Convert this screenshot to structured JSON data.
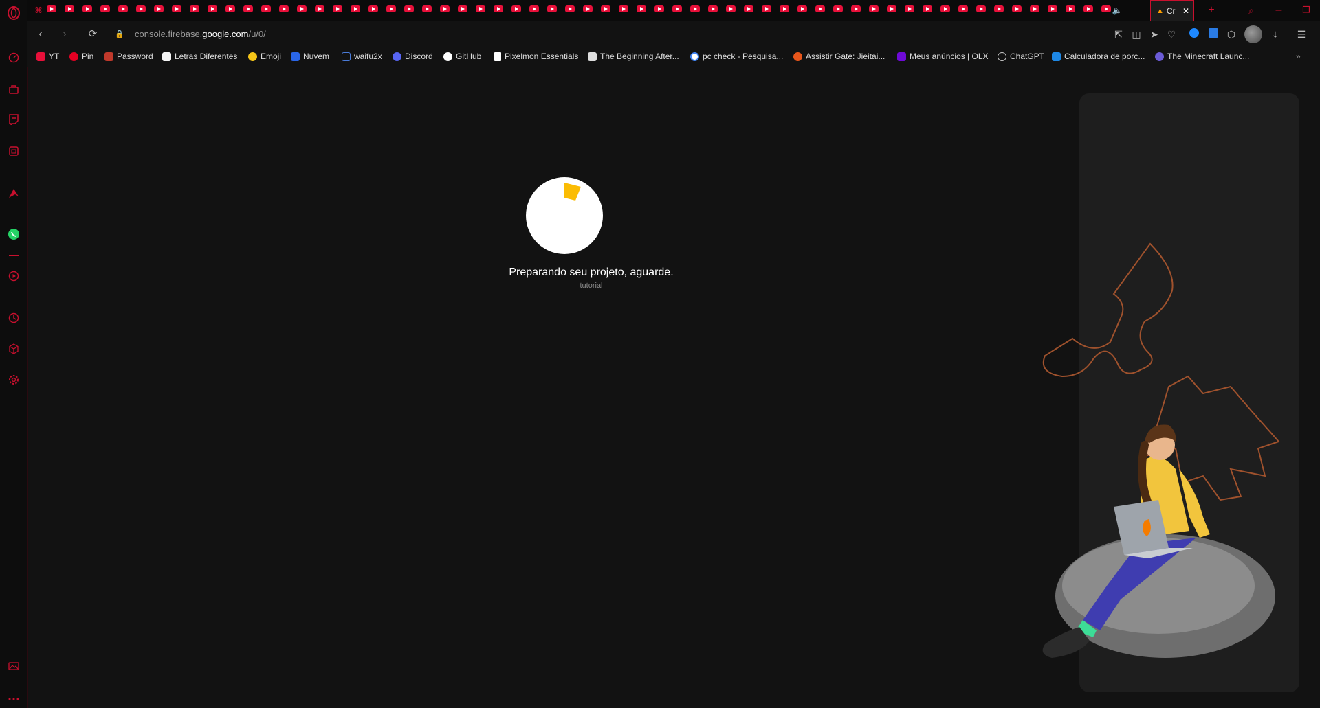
{
  "browser": {
    "active_tab": {
      "title": "Cr"
    },
    "url": {
      "prefix": "console.firebase.",
      "domain": "google.com",
      "path": "/u/0/"
    }
  },
  "bookmarks": [
    {
      "label": "YT",
      "icon": "youtube-icon",
      "color": "#e8103a"
    },
    {
      "label": "Pin",
      "icon": "pinterest-icon",
      "color": "#e60023"
    },
    {
      "label": "Password",
      "icon": "password-icon",
      "color": "#c0392b"
    },
    {
      "label": "Letras Diferentes",
      "icon": "note-icon",
      "color": "#f5f5f5"
    },
    {
      "label": "Emoji",
      "icon": "emoji-icon",
      "color": "#f5c518"
    },
    {
      "label": "Nuvem",
      "icon": "dropbox-icon",
      "color": "#2a66e8"
    },
    {
      "label": "waifu2x",
      "icon": "waifu2x-icon",
      "color": "#4a7bd8"
    },
    {
      "label": "Discord",
      "icon": "discord-icon",
      "color": "#5865f2"
    },
    {
      "label": "GitHub",
      "icon": "github-icon",
      "color": "#ffffff"
    },
    {
      "label": "Pixelmon Essentials",
      "icon": "document-icon",
      "color": "#ffffff"
    },
    {
      "label": "The Beginning After...",
      "icon": "book-icon",
      "color": "#dddddd"
    },
    {
      "label": "pc check - Pesquisa...",
      "icon": "google-icon",
      "color": "#4285f4"
    },
    {
      "label": "Assistir Gate: Jieitai...",
      "icon": "anime-icon",
      "color": "#e8561b"
    },
    {
      "label": "Meus anúncios | OLX",
      "icon": "olx-icon",
      "color": "#6e0ad6"
    },
    {
      "label": "ChatGPT",
      "icon": "chatgpt-icon",
      "color": "#cccccc"
    },
    {
      "label": "Calculadora de porc...",
      "icon": "calculator-icon",
      "color": "#1e88e5"
    },
    {
      "label": "The Minecraft Launc...",
      "icon": "minecraft-icon",
      "color": "#6b5bd6"
    }
  ],
  "main": {
    "loading_text": "Preparando seu projeto, aguarde.",
    "loading_subtext": "tutorial"
  },
  "colors": {
    "accent": "#c8102e",
    "background": "#121212",
    "loader_highlight": "#fbbc04"
  }
}
